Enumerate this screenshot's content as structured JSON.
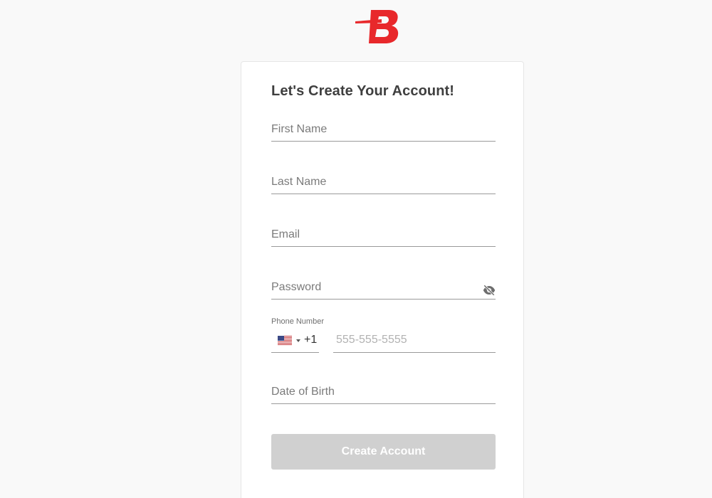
{
  "brand": {
    "logo_icon": "b-logo-icon",
    "accent_color": "#e8282b"
  },
  "form": {
    "title": "Let's Create Your Account!",
    "first_name_label": "First Name",
    "last_name_label": "Last Name",
    "email_label": "Email",
    "password_label": "Password",
    "password_toggle_icon": "eye-slash-icon",
    "phone_caption": "Phone Number",
    "phone_country_icon": "us-flag-icon",
    "phone_dial_code": "+1",
    "phone_placeholder": "555-555-5555",
    "dob_label": "Date of Birth",
    "submit_label": "Create Account",
    "submit_color": "#d0d0d0"
  }
}
